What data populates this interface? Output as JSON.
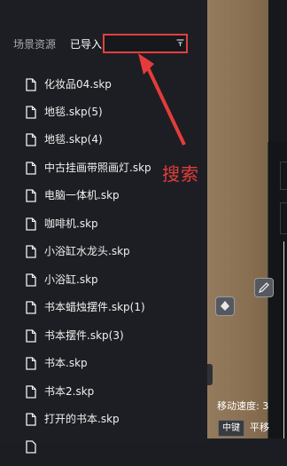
{
  "tabs": {
    "scene_assets": "场景资源",
    "imported": "已导入"
  },
  "search": {
    "value": "",
    "placeholder": ""
  },
  "annotation": {
    "text": "搜索",
    "color": "#e43c3a"
  },
  "files": [
    "化妆品04.skp",
    "地毯.skp(5)",
    "地毯.skp(4)",
    "中古挂画带照画灯.skp",
    "电脑一体机.skp",
    "咖啡机.skp",
    "小浴缸水龙头.skp",
    "小浴缸.skp",
    "书本蜡烛摆件.skp(1)",
    "书本摆件.skp(3)",
    "书本.skp",
    "书本2.skp",
    "打开的书本.skp"
  ],
  "viewport": {
    "move_speed_label": "移动速度: 3",
    "middle_key_chip": "中键",
    "pan_label": "平移"
  },
  "colors": {
    "accent_red": "#e1403f",
    "panel_bg": "#1d1e23",
    "viewport_bg": "#8e7558"
  },
  "icons": [
    "file-icon",
    "filter-icon",
    "fill-bucket-icon",
    "pencil-icon"
  ]
}
